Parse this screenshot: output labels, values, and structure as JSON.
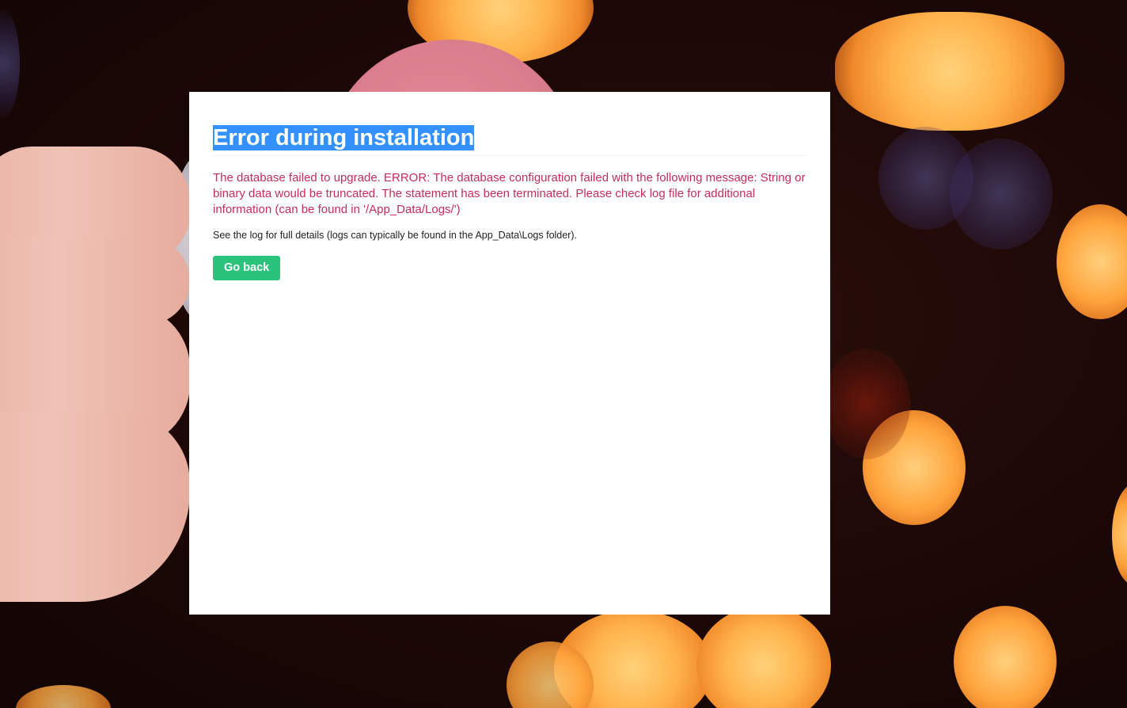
{
  "installer": {
    "title": "Error during installation",
    "error_message": "The database failed to upgrade. ERROR: The database configuration failed with the following message: String or binary data would be truncated. The statement has been terminated. Please check log file for additional information (can be found in '/App_Data/Logs/')",
    "details": "See the log for full details (logs can typically be found in the App_Data\\Logs folder).",
    "go_back_label": "Go back"
  },
  "colors": {
    "title": "#1b264f",
    "title_selection": "#3390ff",
    "error_text": "#c72d5a",
    "button": "#2bc37c",
    "card": "#ffffff"
  }
}
